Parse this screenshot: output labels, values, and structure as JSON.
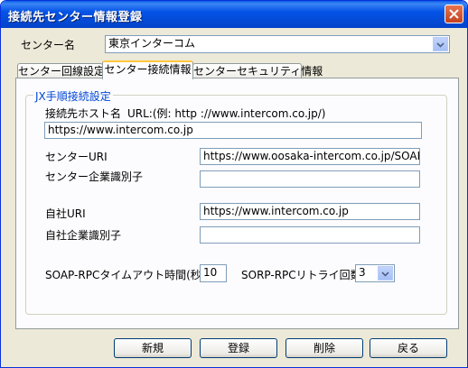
{
  "window": {
    "title": "接続先センター情報登録"
  },
  "center_name": {
    "label": "センター名",
    "value": "東京インターコム"
  },
  "tabs": [
    {
      "label": "センター回線設定"
    },
    {
      "label": "センター接続情報"
    },
    {
      "label": "センターセキュリティ情報"
    }
  ],
  "group": {
    "legend": "JX手順接続設定"
  },
  "host": {
    "label": "接続先ホスト名",
    "hint": "URL:(例: http ://www.intercom.co.jp/)",
    "value": "https://www.intercom.co.jp"
  },
  "center_uri": {
    "label": "センターURI",
    "value": "https://www.oosaka-intercom.co.jp/SOAP-SS"
  },
  "center_company_id": {
    "label": "センター企業識別子",
    "value": ""
  },
  "own_uri": {
    "label": "自社URI",
    "value": "https://www.intercom.co.jp"
  },
  "own_company_id": {
    "label": "自社企業識別子",
    "value": ""
  },
  "timeout": {
    "label": "SOAP-RPCタイムアウト時間(秒)",
    "value": "10"
  },
  "retry": {
    "label": "SORP-RPCリトライ回数",
    "value": "3"
  },
  "buttons": {
    "new": "新規",
    "register": "登録",
    "delete": "削除",
    "back": "戻る"
  }
}
